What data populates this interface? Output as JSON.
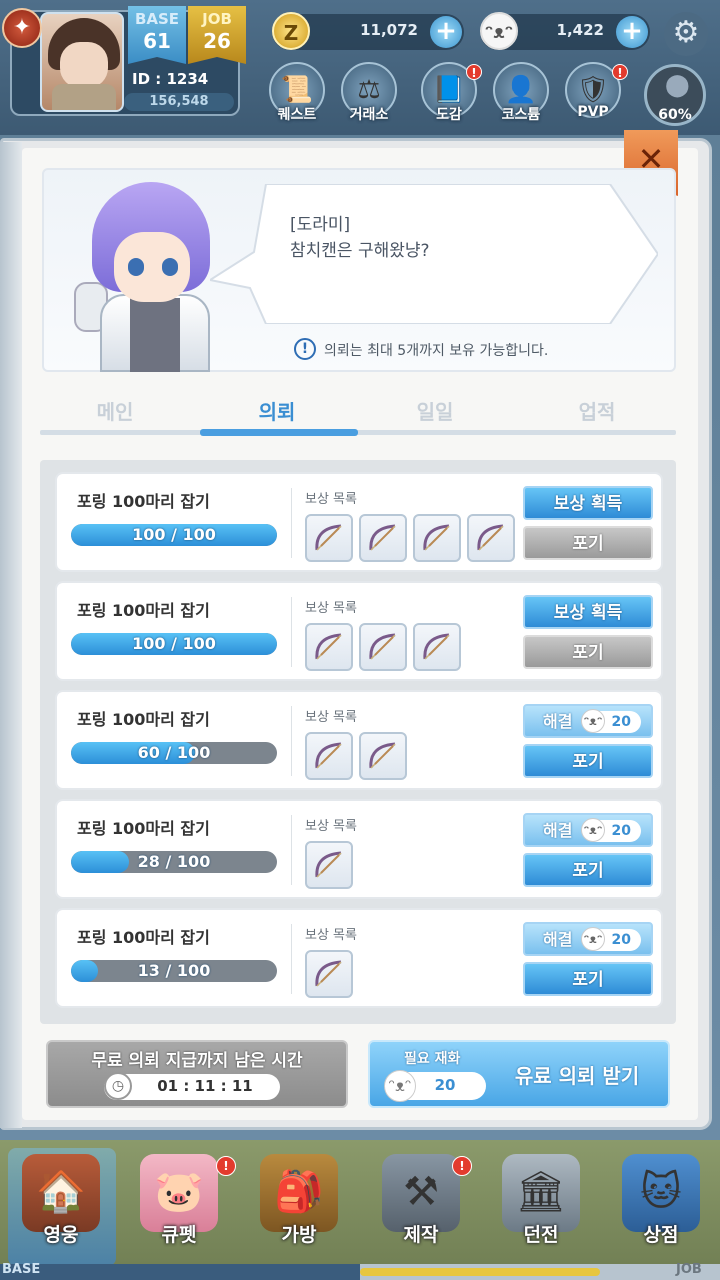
{
  "player": {
    "base_label": "BASE",
    "base_level": "61",
    "job_label": "JOB",
    "job_level": "26",
    "id_text": "ID : 1234",
    "exp": "156,548"
  },
  "currency": {
    "zeny_icon": "Z",
    "zeny": "11,072",
    "gem": "1,422"
  },
  "top_menu": [
    {
      "label": "퀘스트",
      "icon": "scroll-icon",
      "badge": false
    },
    {
      "label": "거래소",
      "icon": "scale-icon",
      "badge": false
    },
    {
      "label": "도감",
      "icon": "book-icon",
      "badge": true
    },
    {
      "label": "코스튬",
      "icon": "costume-icon",
      "badge": false
    },
    {
      "label": "PVP",
      "icon": "pvp-shield-icon",
      "badge": true
    }
  ],
  "map_percent": "60%",
  "npc": {
    "name": "[도라미]",
    "line": "참치캔은 구해왔냥?",
    "info": "의뢰는 최대 5개까지 보유 가능합니다."
  },
  "tabs": [
    "메인",
    "의뢰",
    "일일",
    "업적"
  ],
  "active_tab": "의뢰",
  "quests": [
    {
      "title": "포링 100마리 잡기",
      "progress": "100 / 100",
      "fraction": 1.0,
      "reward_label": "보상 목록",
      "rewards": 4,
      "btn1": "보상 획득",
      "btn1_type": "claim",
      "btn2": "포기",
      "btn2_type": "gray"
    },
    {
      "title": "포링 100마리 잡기",
      "progress": "100 / 100",
      "fraction": 1.0,
      "reward_label": "보상 목록",
      "rewards": 3,
      "btn1": "보상 획득",
      "btn1_type": "claim",
      "btn2": "포기",
      "btn2_type": "gray"
    },
    {
      "title": "포링 100마리 잡기",
      "progress": "60 / 100",
      "fraction": 0.6,
      "reward_label": "보상 목록",
      "rewards": 2,
      "btn1": "해결",
      "btn1_type": "resolve",
      "btn1_cost": "20",
      "btn2": "포기",
      "btn2_type": "blue"
    },
    {
      "title": "포링 100마리 잡기",
      "progress": "28 / 100",
      "fraction": 0.28,
      "reward_label": "보상 목록",
      "rewards": 1,
      "btn1": "해결",
      "btn1_type": "resolve",
      "btn1_cost": "20",
      "btn2": "포기",
      "btn2_type": "blue"
    },
    {
      "title": "포링 100마리 잡기",
      "progress": "13 / 100",
      "fraction": 0.13,
      "reward_label": "보상 목록",
      "rewards": 1,
      "btn1": "해결",
      "btn1_type": "resolve",
      "btn1_cost": "20",
      "btn2": "포기",
      "btn2_type": "blue"
    }
  ],
  "timer": {
    "label": "무료 의뢰 지급까지  남은 시간",
    "value": "01 : 11 : 11"
  },
  "paid": {
    "need_label": "필요 재화",
    "cost": "20",
    "label": "유료 의뢰 받기"
  },
  "bottom_nav": [
    {
      "label": "영웅",
      "icon": "hero-icon",
      "badge": false,
      "active": true
    },
    {
      "label": "큐펫",
      "icon": "cupet-icon",
      "badge": true,
      "active": false
    },
    {
      "label": "가방",
      "icon": "bag-icon",
      "badge": false,
      "active": false
    },
    {
      "label": "제작",
      "icon": "anvil-icon",
      "badge": true,
      "active": false
    },
    {
      "label": "던전",
      "icon": "dungeon-icon",
      "badge": false,
      "active": false
    },
    {
      "label": "상점",
      "icon": "shop-icon",
      "badge": false,
      "active": false
    }
  ],
  "bottom_bar": {
    "base": "BASE",
    "job": "JOB"
  },
  "colors": {
    "accent": "#3a8ed2",
    "progress": "#2c8fd8",
    "close": "#d9652c"
  }
}
